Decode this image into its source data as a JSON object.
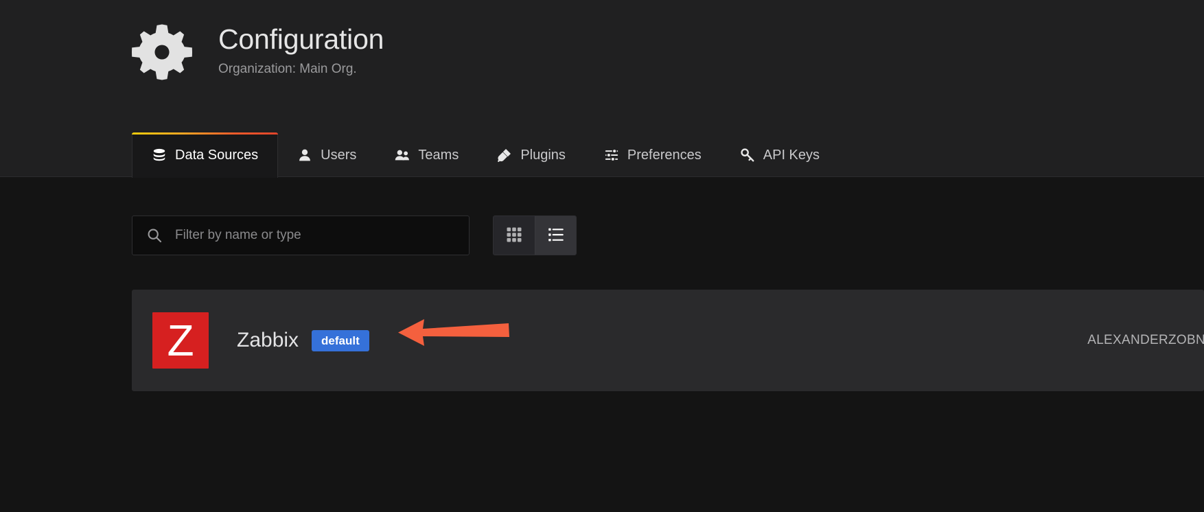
{
  "header": {
    "icon": "gear-icon",
    "title": "Configuration",
    "subtitle": "Organization: Main Org."
  },
  "tabs": [
    {
      "label": "Data Sources",
      "icon": "database-icon",
      "active": true
    },
    {
      "label": "Users",
      "icon": "user-icon",
      "active": false
    },
    {
      "label": "Teams",
      "icon": "users-group-icon",
      "active": false
    },
    {
      "label": "Plugins",
      "icon": "plug-icon",
      "active": false
    },
    {
      "label": "Preferences",
      "icon": "sliders-icon",
      "active": false
    },
    {
      "label": "API Keys",
      "icon": "key-icon",
      "active": false
    }
  ],
  "toolbar": {
    "search": {
      "icon": "search-icon",
      "value": "",
      "placeholder": "Filter by name or type"
    },
    "view_toggle": {
      "grid": {
        "icon": "grid-view-icon",
        "active": false
      },
      "list": {
        "icon": "list-view-icon",
        "active": true
      }
    }
  },
  "datasources": [
    {
      "logo_letter": "Z",
      "logo_color": "#d62020",
      "name": "Zabbix",
      "badge": "default",
      "badge_color": "#3571d9",
      "url": "ALEXANDERZOBN"
    }
  ],
  "annotation": {
    "type": "arrow",
    "direction": "left",
    "color": "#f4603e"
  },
  "colors": {
    "page_background": "#141414",
    "header_background": "#202021",
    "active_tab_background": "#181819",
    "row_background": "#2a2a2c",
    "tab_accent_gradient_start": "#f2cc0c",
    "tab_accent_gradient_end": "#e0442b"
  }
}
